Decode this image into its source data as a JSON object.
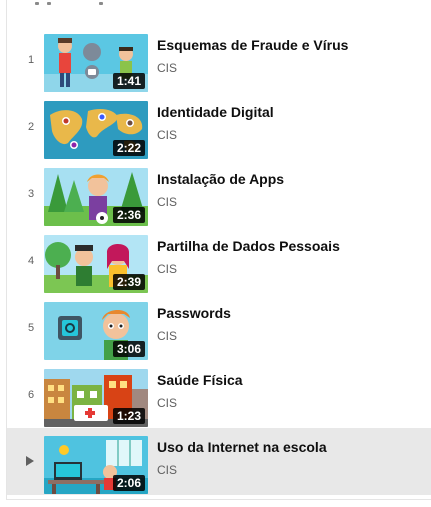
{
  "playlist": {
    "items": [
      {
        "index": "1",
        "title": "Esquemas de Fraude e Vírus",
        "channel": "CIS",
        "duration": "1:41",
        "thumbnail": "fraud-virus-cartoon",
        "active": false
      },
      {
        "index": "2",
        "title": "Identidade Digital",
        "channel": "CIS",
        "duration": "2:22",
        "thumbnail": "world-map-avatars",
        "active": false
      },
      {
        "index": "3",
        "title": "Instalação de Apps",
        "channel": "CIS",
        "duration": "2:36",
        "thumbnail": "boy-in-park",
        "active": false
      },
      {
        "index": "4",
        "title": "Partilha de Dados Pessoais",
        "channel": "CIS",
        "duration": "2:39",
        "thumbnail": "kids-outdoors",
        "active": false
      },
      {
        "index": "5",
        "title": "Passwords",
        "channel": "CIS",
        "duration": "3:06",
        "thumbnail": "safe-and-boy",
        "active": false
      },
      {
        "index": "6",
        "title": "Saúde Física",
        "channel": "CIS",
        "duration": "1:23",
        "thumbnail": "city-ambulance",
        "active": false
      },
      {
        "index": "",
        "title": "Uso da Internet na escola",
        "channel": "CIS",
        "duration": "2:06",
        "thumbnail": "classroom-desk",
        "active": true
      }
    ],
    "icons": {
      "now_playing": "play-triangle-icon"
    },
    "colors": {
      "active_row": "#e8e8e8",
      "duration_badge": "#000000",
      "secondary_text": "#606060"
    }
  }
}
